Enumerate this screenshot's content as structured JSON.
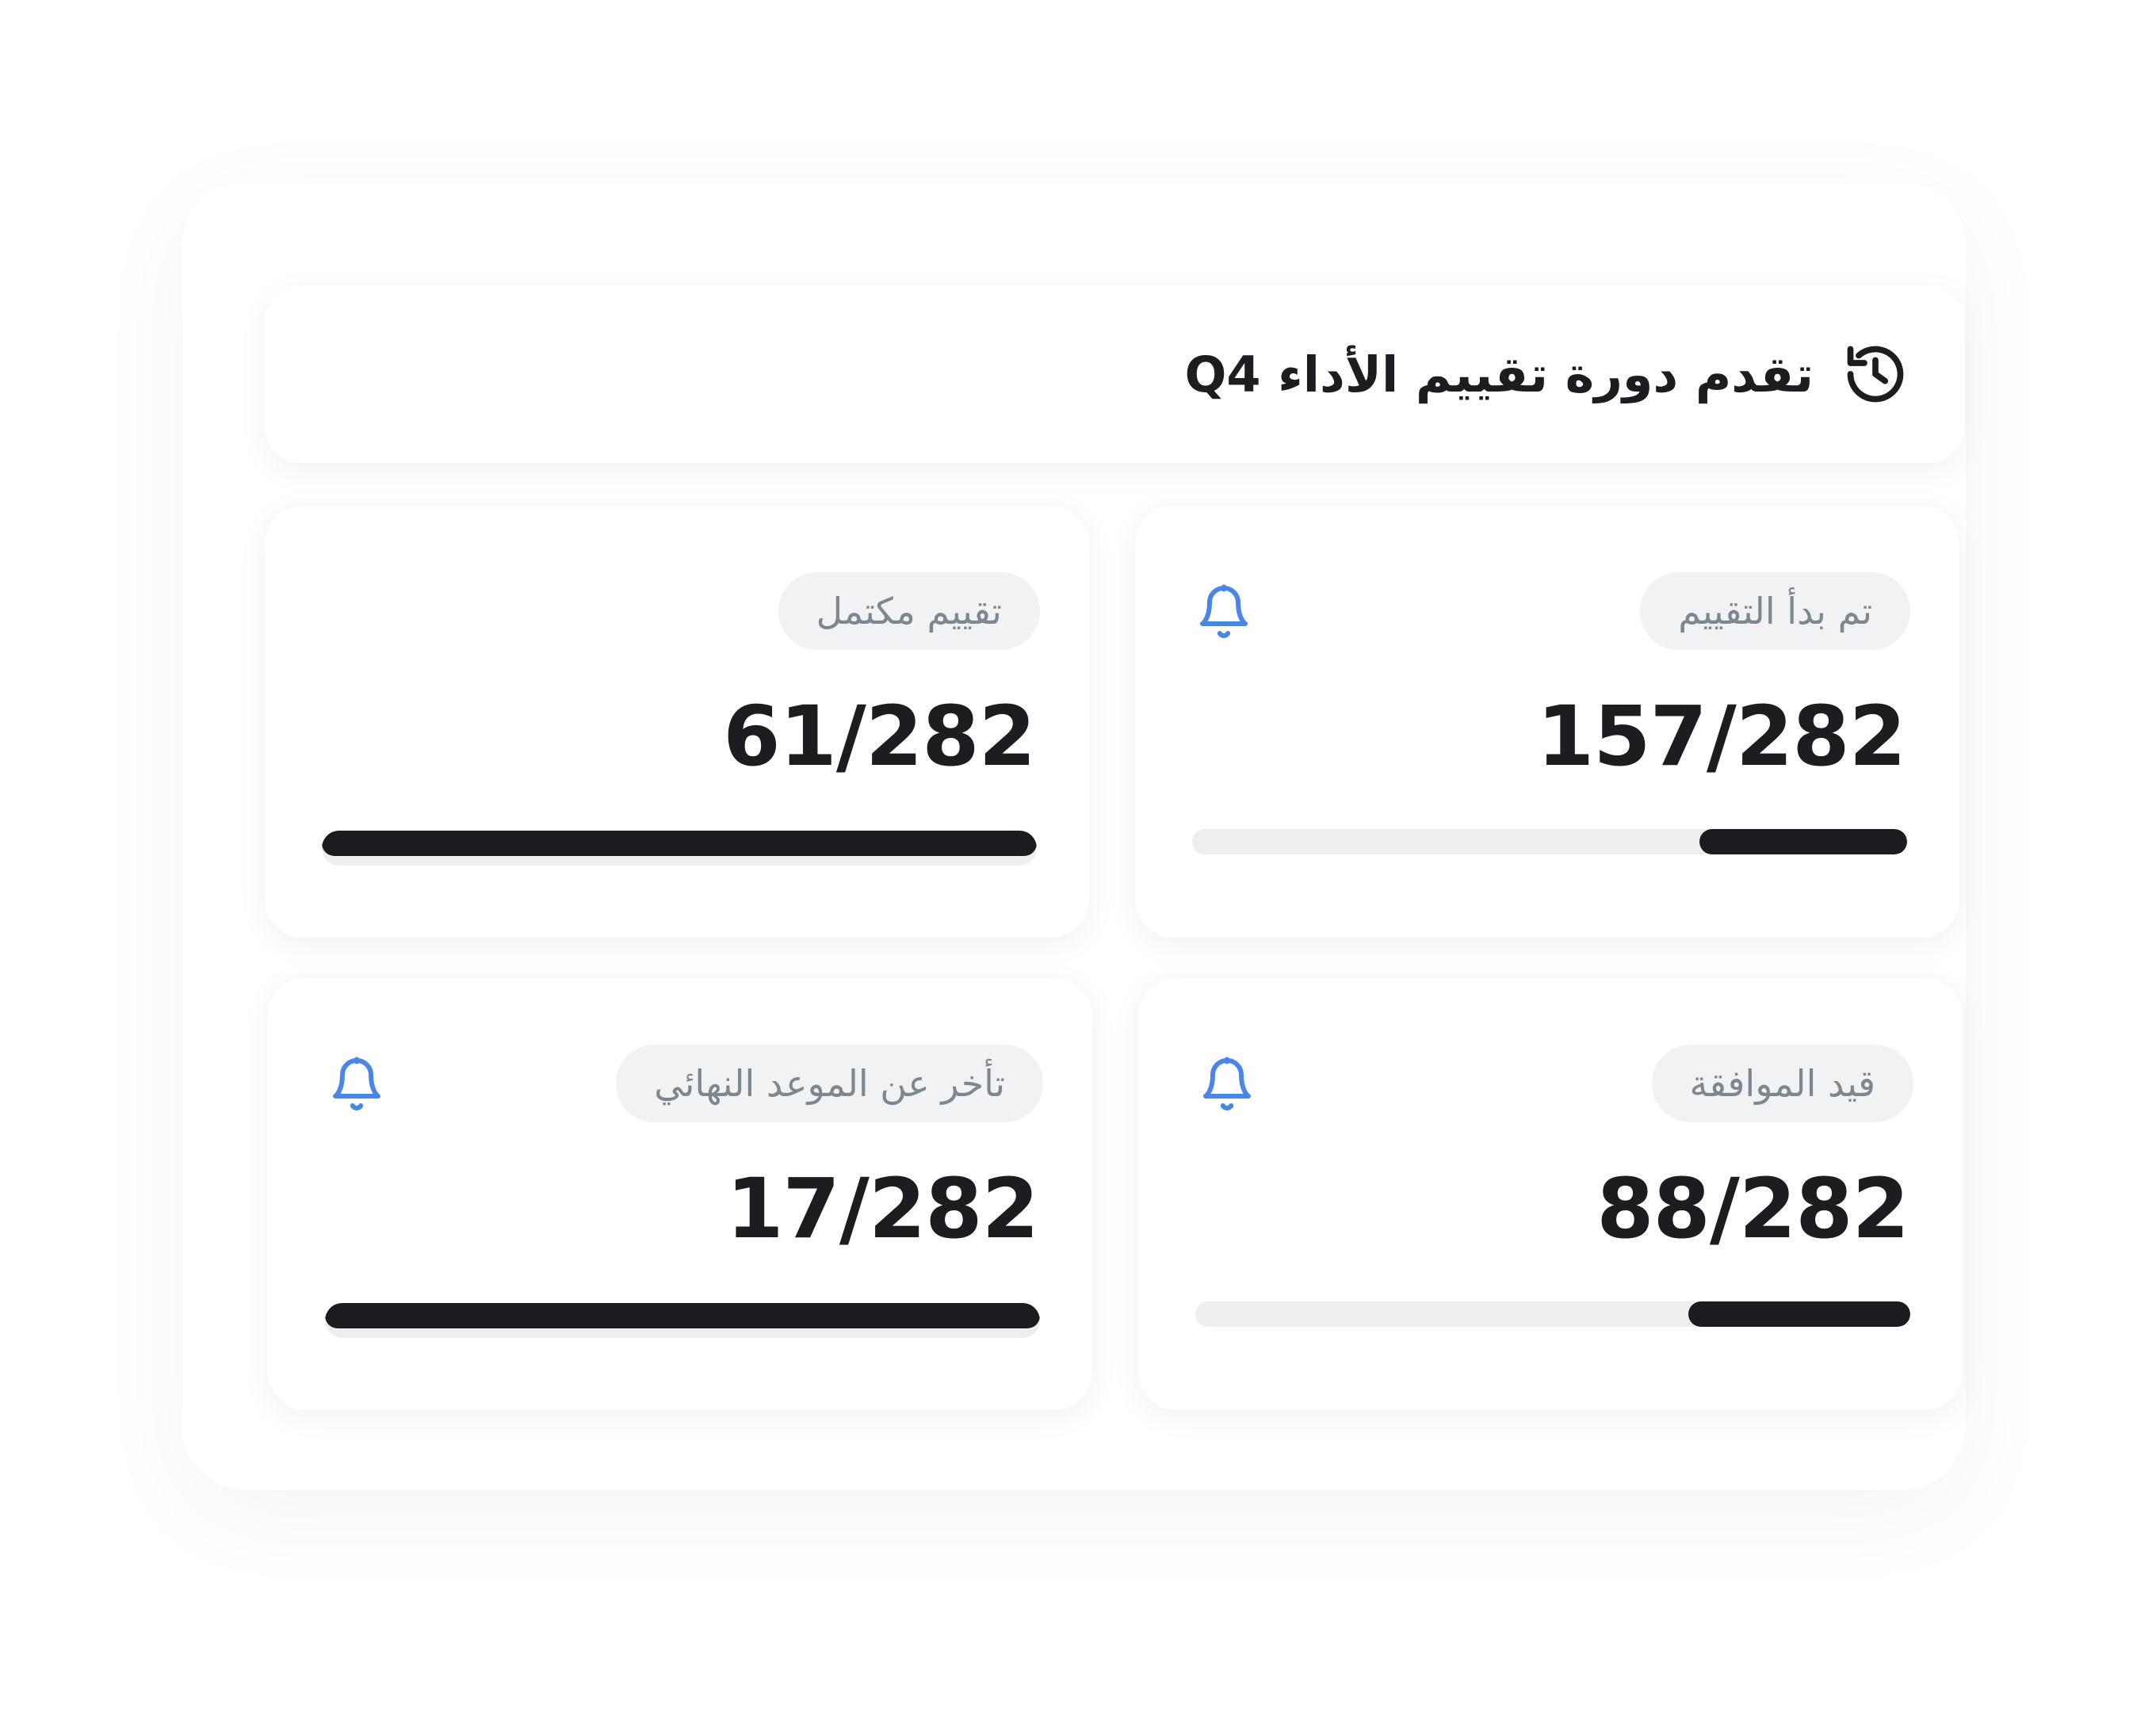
{
  "header": {
    "title": "تقدم دورة تقييم الأداء Q4",
    "icon": "history-icon"
  },
  "cards": [
    {
      "id": "evaluation-started",
      "label": "تم بدأ التقييم",
      "value": "157/282",
      "progress": 0.29,
      "has_bell": true
    },
    {
      "id": "evaluation-completed",
      "label": "تقييم مكتمل",
      "value": "61/282",
      "progress": 1.0,
      "has_bell": false
    },
    {
      "id": "pending-approval",
      "label": "قيد الموافقة",
      "value": "88/282",
      "progress": 0.31,
      "has_bell": true
    },
    {
      "id": "overdue",
      "label": "تأخر عن الموعد النهائي",
      "value": "17/282",
      "progress": 1.0,
      "has_bell": true
    }
  ],
  "colors": {
    "bell": "#4a86e8",
    "bar_fill": "#1b1c20",
    "bar_track": "#eceef0",
    "pill_bg": "#f1f2f3",
    "pill_text": "#7d878f",
    "title_text": "#1c1c21"
  }
}
